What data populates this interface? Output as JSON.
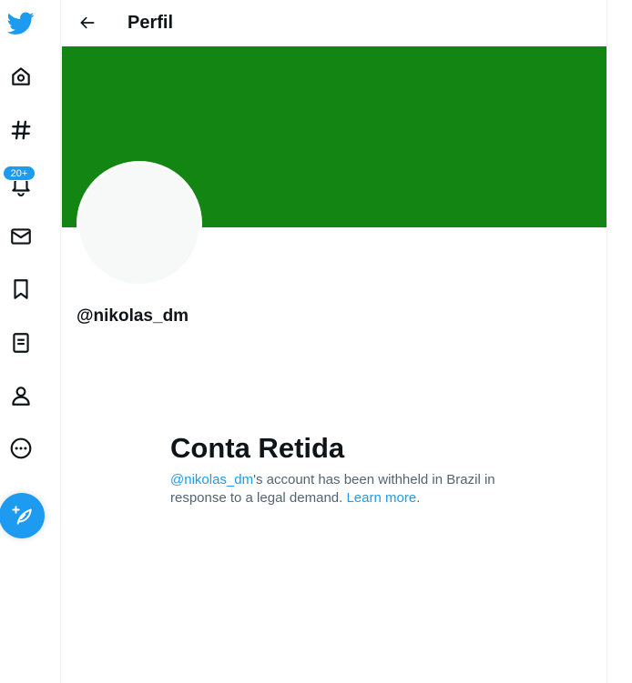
{
  "header": {
    "title": "Perfil",
    "back_icon": "arrow-left-icon"
  },
  "sidebar": {
    "items": [
      {
        "name": "logo",
        "icon": "twitter-bird-icon"
      },
      {
        "name": "home",
        "icon": "home-icon"
      },
      {
        "name": "explore",
        "icon": "hashtag-icon"
      },
      {
        "name": "notifications",
        "icon": "bell-icon"
      },
      {
        "name": "messages",
        "icon": "envelope-icon"
      },
      {
        "name": "bookmarks",
        "icon": "bookmark-icon"
      },
      {
        "name": "lists",
        "icon": "list-icon"
      },
      {
        "name": "profile",
        "icon": "person-icon"
      },
      {
        "name": "more",
        "icon": "more-circle-icon"
      }
    ],
    "notifications_badge": "20+",
    "compose_icon": "feather-plus-icon"
  },
  "profile": {
    "handle": "@nikolas_dm",
    "banner_color": "#138512",
    "avatar_color": "#f7f9f9"
  },
  "withheld": {
    "title": "Conta Retida",
    "handle_link": "@nikolas_dm",
    "message": "'s account has been withheld in Brazil in response to a legal demand. ",
    "learn_more": "Learn more",
    "end": "."
  },
  "colors": {
    "accent": "#1d9bf0",
    "text": "#0f1419",
    "secondary_text": "#536471"
  }
}
